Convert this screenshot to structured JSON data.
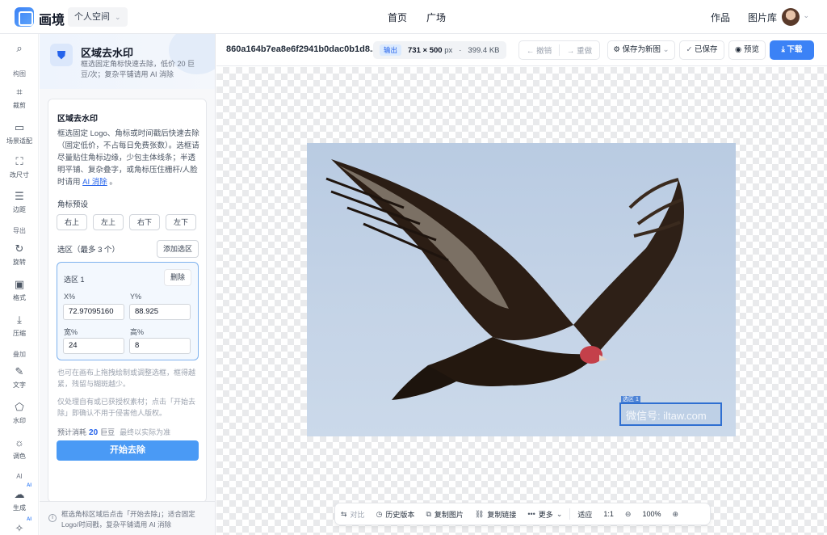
{
  "brand": {
    "name": "画境"
  },
  "topbar": {
    "space_selector": "个人空间",
    "nav_center": [
      "首页",
      "广场"
    ],
    "nav_right": [
      "作品",
      "图片库"
    ]
  },
  "rail": {
    "items": [
      {
        "label": "",
        "icon": "search-icon"
      },
      {
        "label": "构图",
        "icon": "",
        "section": true
      },
      {
        "label": "裁剪",
        "icon": "crop-icon"
      },
      {
        "label": "场景适配",
        "icon": "monitor-icon"
      },
      {
        "label": "改尺寸",
        "icon": "resize-icon"
      },
      {
        "label": "边距",
        "icon": "padding-icon"
      },
      {
        "label": "导出",
        "icon": "",
        "section": true
      },
      {
        "label": "旋转",
        "icon": "rotate-icon"
      },
      {
        "label": "格式",
        "icon": "image-icon"
      },
      {
        "label": "压缩",
        "icon": "download-icon"
      },
      {
        "label": "叠加",
        "icon": "",
        "section": true
      },
      {
        "label": "文字",
        "icon": "pen-icon"
      },
      {
        "label": "水印",
        "icon": "watermark-icon"
      },
      {
        "label": "调色",
        "icon": "sun-icon"
      },
      {
        "label": "AI",
        "icon": "",
        "section": true
      },
      {
        "label": "生成",
        "icon": "cloud-upload-icon",
        "badge": "AI"
      },
      {
        "label": "",
        "icon": "sparkle-icon",
        "badge": "AI"
      }
    ]
  },
  "panel": {
    "title": "区域去水印",
    "subtitle": "框选固定角标快速去除，低价 20 巨豆/次；复杂平铺请用 AI 消除",
    "card_title": "区域去水印",
    "desc_main": "框选固定 Logo、角标或时间戳后快速去除（固定低价，不占每日免费张数）。选框请尽量贴住角标边缘，少包主体线条；半透明平铺、复杂叠字，或角标压住栅杆/人脸时请用",
    "desc_link": "AI 消除",
    "desc_end": "。",
    "preset_label": "角标预设",
    "presets": [
      "右上",
      "左上",
      "右下",
      "左下"
    ],
    "selection_label": "选区（最多 3 个）",
    "add_selection": "添加选区",
    "region": {
      "title": "选区 1",
      "delete": "删除",
      "x_label": "X%",
      "x_value": "72.97095160",
      "y_label": "Y%",
      "y_value": "88.925",
      "w_label": "宽%",
      "w_value": "24",
      "h_label": "高%",
      "h_value": "8"
    },
    "hint1": "也可在画布上拖拽绘制或调整选框，框得越紧，残留与糊斑越少。",
    "hint2": "仅处理自有或已获授权素材；点击「开始去除」即确认不用于侵害他人版权。",
    "cost_label": "预计消耗",
    "cost_value": "20",
    "cost_unit": "巨豆",
    "cost_note": "最终以实际为准",
    "start": "开始去除",
    "footer": "框选角标区域后点击「开始去除」；适合固定 Logo/时间戳，复杂平铺请用 AI 消除"
  },
  "toolbar": {
    "file_name": "860a164b7ea8e6f2941b0dac0b1d8...",
    "output_badge": "输出",
    "dimensions": "731 × 500",
    "dim_unit": "px",
    "file_size": "399.4 KB",
    "undo": "撤销",
    "redo": "重做",
    "save_as_new": "保存为新图",
    "saved": "已保存",
    "preview": "预览",
    "download": "下载"
  },
  "canvas": {
    "selection_tag": "选区 1",
    "watermark_text": "微信号: iltaw.com"
  },
  "bottom_bar": {
    "compare": "对比",
    "history": "历史版本",
    "copy_image": "复制图片",
    "copy_link": "复制链接",
    "more": "更多",
    "fit": "适应",
    "one_to_one": "1:1",
    "zoom": "100%"
  },
  "colors": {
    "accent": "#3b82f6",
    "start_button": "#4a9af5",
    "selection": "#2f6fd1"
  }
}
